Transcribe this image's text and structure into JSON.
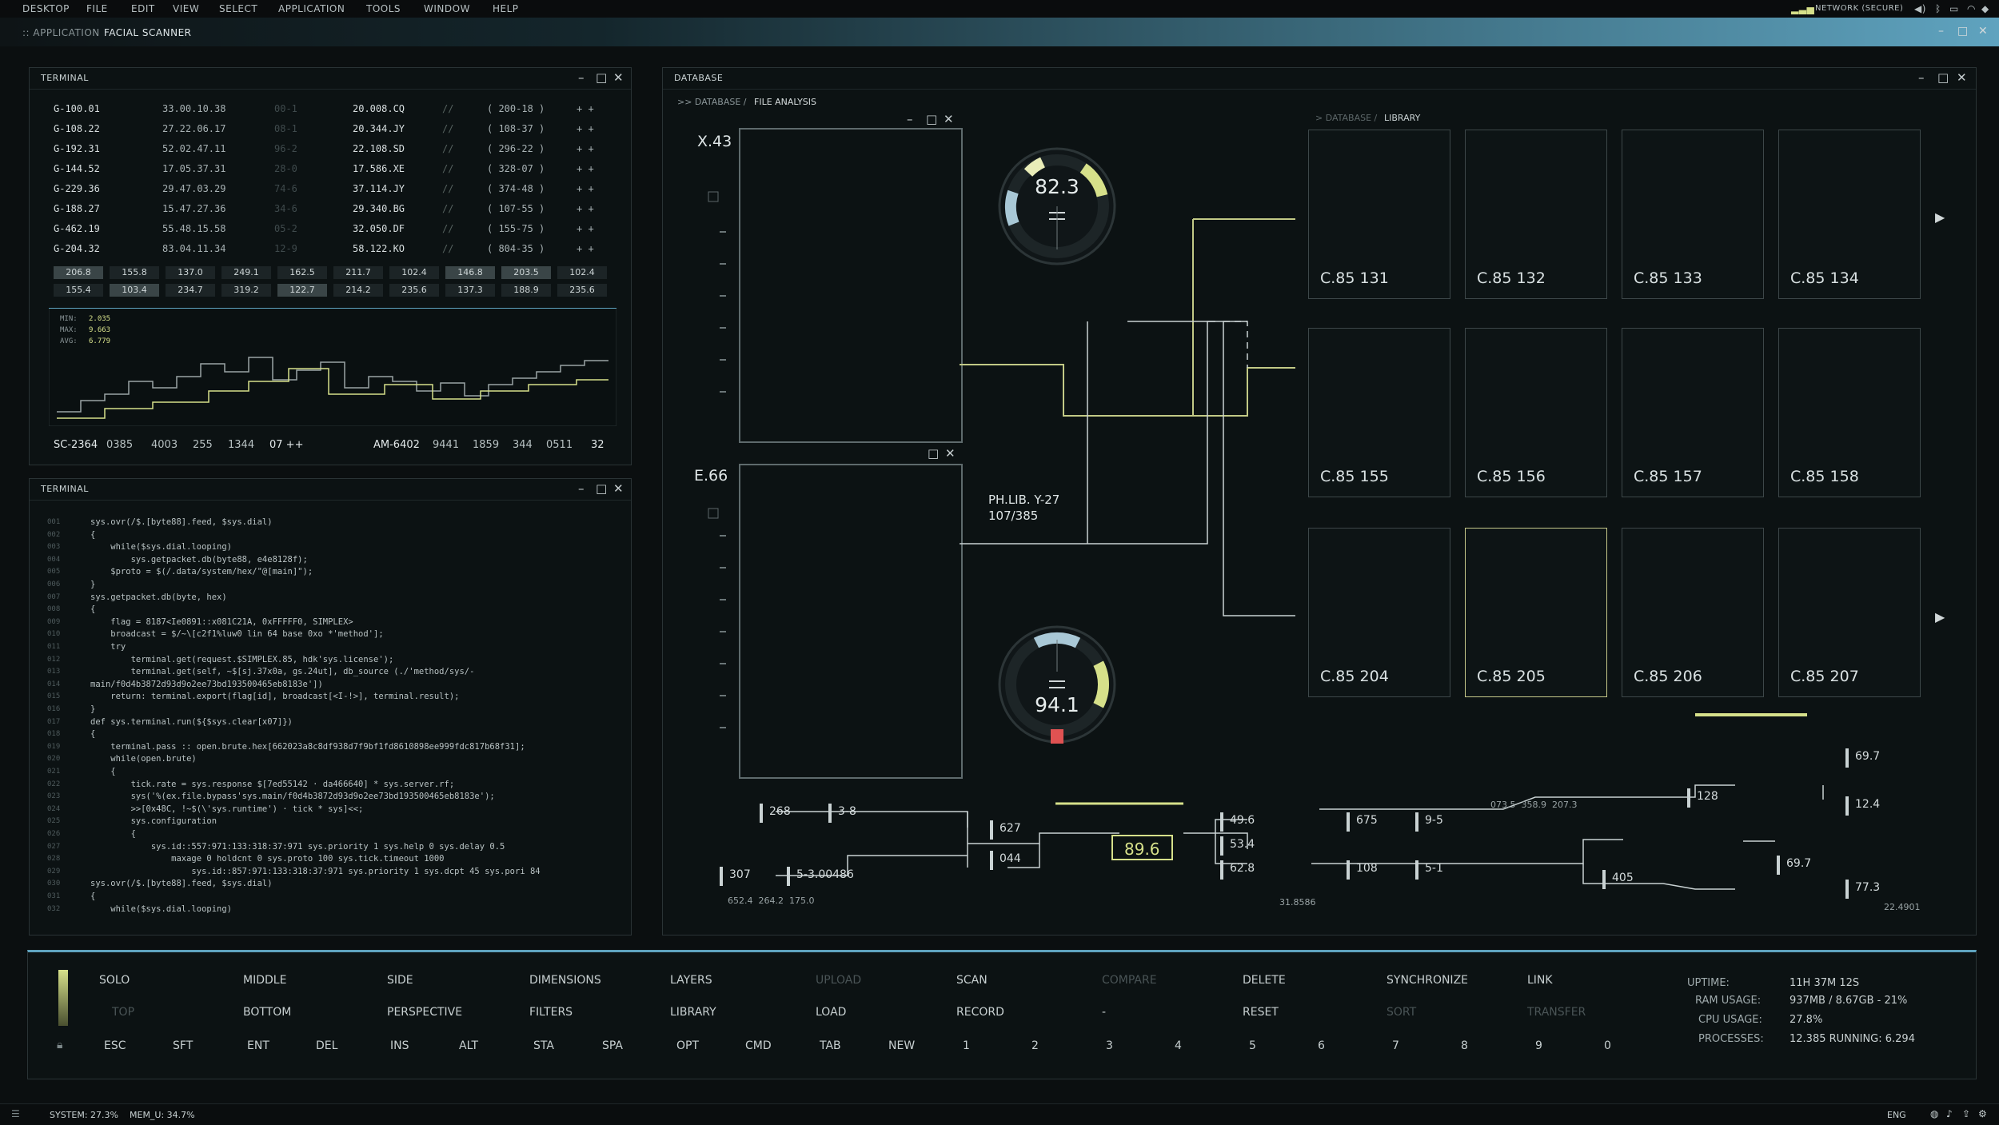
{
  "menubar": {
    "items": [
      "DESKTOP",
      "FILE",
      "EDIT",
      "VIEW",
      "SELECT",
      "APPLICATION",
      "TOOLS",
      "WINDOW",
      "HELP"
    ],
    "network": "NETWORK (SECURE)"
  },
  "titlebar": {
    "app": ":: APPLICATION",
    "name": "FACIAL SCANNER"
  },
  "terminal1": {
    "title": "TERMINAL",
    "rows": [
      {
        "id": "G-100.01",
        "time": "33.00.10.38",
        "code": "00-1",
        "addr": "20.008.CQ",
        "sep": "//",
        "range": "( 200-18 )",
        "mark": "+ +"
      },
      {
        "id": "G-108.22",
        "time": "27.22.06.17",
        "code": "08-1",
        "addr": "20.344.JY",
        "sep": "//",
        "range": "( 108-37 )",
        "mark": "+ +"
      },
      {
        "id": "G-192.31",
        "time": "52.02.47.11",
        "code": "96-2",
        "addr": "22.108.SD",
        "sep": "//",
        "range": "( 296-22 )",
        "mark": "+ +"
      },
      {
        "id": "G-144.52",
        "time": "17.05.37.31",
        "code": "28-0",
        "addr": "17.586.XE",
        "sep": "//",
        "range": "( 328-07 )",
        "mark": "+ +"
      },
      {
        "id": "G-229.36",
        "time": "29.47.03.29",
        "code": "74-6",
        "addr": "37.114.JY",
        "sep": "//",
        "range": "( 374-48 )",
        "mark": "+ +"
      },
      {
        "id": "G-188.27",
        "time": "15.47.27.36",
        "code": "34-6",
        "addr": "29.340.BG",
        "sep": "//",
        "range": "( 107-55 )",
        "mark": "+ +"
      },
      {
        "id": "G-462.19",
        "time": "55.48.15.58",
        "code": "05-2",
        "addr": "32.050.DF",
        "sep": "//",
        "range": "( 155-75 )",
        "mark": "+ +"
      },
      {
        "id": "G-204.32",
        "time": "83.04.11.34",
        "code": "12-9",
        "addr": "58.122.KO",
        "sep": "//",
        "range": "( 804-35 )",
        "mark": "+ +"
      }
    ],
    "grid_row1": [
      "206.8",
      "155.8",
      "137.0",
      "249.1",
      "162.5",
      "211.7",
      "102.4",
      "146.8",
      "203.5",
      "102.4"
    ],
    "grid_row2": [
      "155.4",
      "103.4",
      "234.7",
      "319.2",
      "122.7",
      "214.2",
      "235.6",
      "137.3",
      "188.9",
      "235.6"
    ],
    "stats": {
      "min_label": "MIN:",
      "min": "2.035",
      "max_label": "MAX:",
      "max": "9.663",
      "avg_label": "AVG:",
      "avg": "6.779"
    },
    "footer_left": [
      "SC-2364",
      "0385",
      "4003",
      "255",
      "1344",
      "07 ++"
    ],
    "footer_right": [
      "AM-6402",
      "9441",
      "1859",
      "344",
      "0511",
      "32"
    ]
  },
  "terminal2": {
    "title": "TERMINAL",
    "lines": [
      {
        "n": "001",
        "t": "sys.ovr(/$.[byte88].feed, $sys.dial)"
      },
      {
        "n": "002",
        "t": "{"
      },
      {
        "n": "003",
        "t": "    while($sys.dial.looping)"
      },
      {
        "n": "004",
        "t": "        sys.getpacket.db(byte88, e4e8128f);"
      },
      {
        "n": "005",
        "t": "    $proto = $(/.data/system/hex/\"@[main]\");"
      },
      {
        "n": "006",
        "t": "}"
      },
      {
        "n": "007",
        "t": "sys.getpacket.db(byte, hex)"
      },
      {
        "n": "008",
        "t": "{"
      },
      {
        "n": "009",
        "t": "    flag = 8187<Ie0891::x081C21A, 0xFFFFF0, SIMPLEX>"
      },
      {
        "n": "010",
        "t": "    broadcast = $/~\\[c2f1%luw0 lin 64 base 0xo *'method'];"
      },
      {
        "n": "011",
        "t": "    try"
      },
      {
        "n": "012",
        "t": "        terminal.get(request.$SIMPLEX.85, hdk'sys.license');"
      },
      {
        "n": "013",
        "t": "        terminal.get(self, ~$[sj.37x0a, gs.24ut], db_source (./'method/sys/-"
      },
      {
        "n": "014",
        "t": "main/f0d4b3872d93d9o2ee73bd193500465eb8183e'])"
      },
      {
        "n": "015",
        "t": "    return: terminal.export(flag[id], broadcast[<I-!>], terminal.result);"
      },
      {
        "n": "016",
        "t": "}"
      },
      {
        "n": "017",
        "t": "def sys.terminal.run(${$sys.clear[x07]})"
      },
      {
        "n": "018",
        "t": "{"
      },
      {
        "n": "019",
        "t": "    terminal.pass :: open.brute.hex[662023a8c8df938d7f9bf1fd8610898ee999fdc817b68f31];"
      },
      {
        "n": "020",
        "t": "    while(open.brute)"
      },
      {
        "n": "021",
        "t": "    {"
      },
      {
        "n": "022",
        "t": "        tick.rate = sys.response $[7ed55142 · da466640] * sys.server.rf;"
      },
      {
        "n": "023",
        "t": "        sys('%(ex.file.bypass'sys.main/f0d4b3872d93d9o2ee73bd193500465eb8183e');"
      },
      {
        "n": "024",
        "t": "        >>[0x48C, !~$(\\'sys.runtime') · tick * sys]<<;"
      },
      {
        "n": "025",
        "t": "        sys.configuration"
      },
      {
        "n": "026",
        "t": "        {"
      },
      {
        "n": "027",
        "t": "            sys.id::557:971:133:318:37:971 sys.priority 1 sys.help 0 sys.delay 0.5"
      },
      {
        "n": "028",
        "t": "                maxage 0 holdcnt 0 sys.proto 100 sys.tick.timeout 1000"
      },
      {
        "n": "029",
        "t": "                    sys.id::857:971:133:318:37:971 sys.priority 1 sys.dcpt 45 sys.pori 84"
      },
      {
        "n": "030",
        "t": "sys.ovr(/$.[byte88].feed, $sys.dial)"
      },
      {
        "n": "031",
        "t": "{"
      },
      {
        "n": "032",
        "t": "    while($sys.dial.looping)"
      }
    ]
  },
  "database": {
    "title": "DATABASE",
    "breadcrumb_a": ">> DATABASE / ",
    "breadcrumb_b": "FILE ANALYSIS",
    "library_a": "> DATABASE / ",
    "library_b": "LIBRARY",
    "scan1_label": "X.43",
    "scan2_label": "E.66",
    "gauge1": {
      "value": 82.3,
      "label": "82.3"
    },
    "gauge2": {
      "value": 94.1,
      "label": "94.1"
    },
    "phlib_line1": "PH.LIB. Y-27",
    "phlib_line2": "107/385",
    "tiles": [
      "C.85 131",
      "C.85 132",
      "C.85 133",
      "C.85 134",
      "C.85 155",
      "C.85 156",
      "C.85 157",
      "C.85 158",
      "C.85 204",
      "C.85 205",
      "C.85 206",
      "C.85 207"
    ],
    "selected_tile": "C.85 205",
    "nodes": {
      "n268": "268",
      "n38": "3-8",
      "n627": "627",
      "n044": "044",
      "n307": "307",
      "n53": "5-3.00486",
      "center": "89.6",
      "n496": "49.6",
      "n534": "53.4",
      "n628": "62.8",
      "n675": "675",
      "n95": "9-5",
      "n108": "108",
      "n51": "5-1",
      "n128": "128",
      "n405": "405",
      "n697a": "69.7",
      "n124": "12.4",
      "n697b": "69.7",
      "n773": "77.3"
    },
    "captions": {
      "left": "652.4  264.2  175.0",
      "mid": "073.5  358.9  207.3",
      "bottom": "31.8586",
      "right": "22.4901"
    }
  },
  "toolbar": {
    "row1": [
      "SOLO",
      "MIDDLE",
      "SIDE",
      "DIMENSIONS",
      "LAYERS",
      "UPLOAD",
      "SCAN",
      "COMPARE",
      "DELETE",
      "SYNCHRONIZE",
      "LINK"
    ],
    "row1_disabled": [
      false,
      false,
      false,
      false,
      false,
      true,
      false,
      true,
      false,
      false,
      false
    ],
    "row2": [
      "TOP",
      "BOTTOM",
      "PERSPECTIVE",
      "FILTERS",
      "LIBRARY",
      "LOAD",
      "RECORD",
      "-",
      "RESET",
      "SORT",
      "TRANSFER"
    ],
    "row2_disabled": [
      true,
      false,
      false,
      false,
      false,
      false,
      false,
      false,
      false,
      true,
      true
    ],
    "keys": [
      "ESC",
      "SFT",
      "ENT",
      "DEL",
      "INS",
      "ALT",
      "STA",
      "SPA",
      "OPT",
      "CMD",
      "TAB",
      "NEW",
      "1",
      "2",
      "3",
      "4",
      "5",
      "6",
      "7",
      "8",
      "9",
      "0"
    ]
  },
  "sysinfo": {
    "uptime_label": "UPTIME:",
    "uptime": "11H 37M 12S",
    "ram_label": "RAM USAGE:",
    "ram": "937MB / 8.67GB - 21%",
    "cpu_label": "CPU USAGE:",
    "cpu": "27.8%",
    "proc_label": "PROCESSES:",
    "proc": "12.385 RUNNING: 6.294"
  },
  "statusbar": {
    "system": "SYSTEM: 27.3%",
    "mem": "MEM_U: 34.7%",
    "lang": "ENG"
  },
  "colors": {
    "accent": "#d6e08a",
    "accent_dim": "#8a9255",
    "line": "#9fb06a",
    "red": "#e05252",
    "sky": "#5fa3bf"
  }
}
